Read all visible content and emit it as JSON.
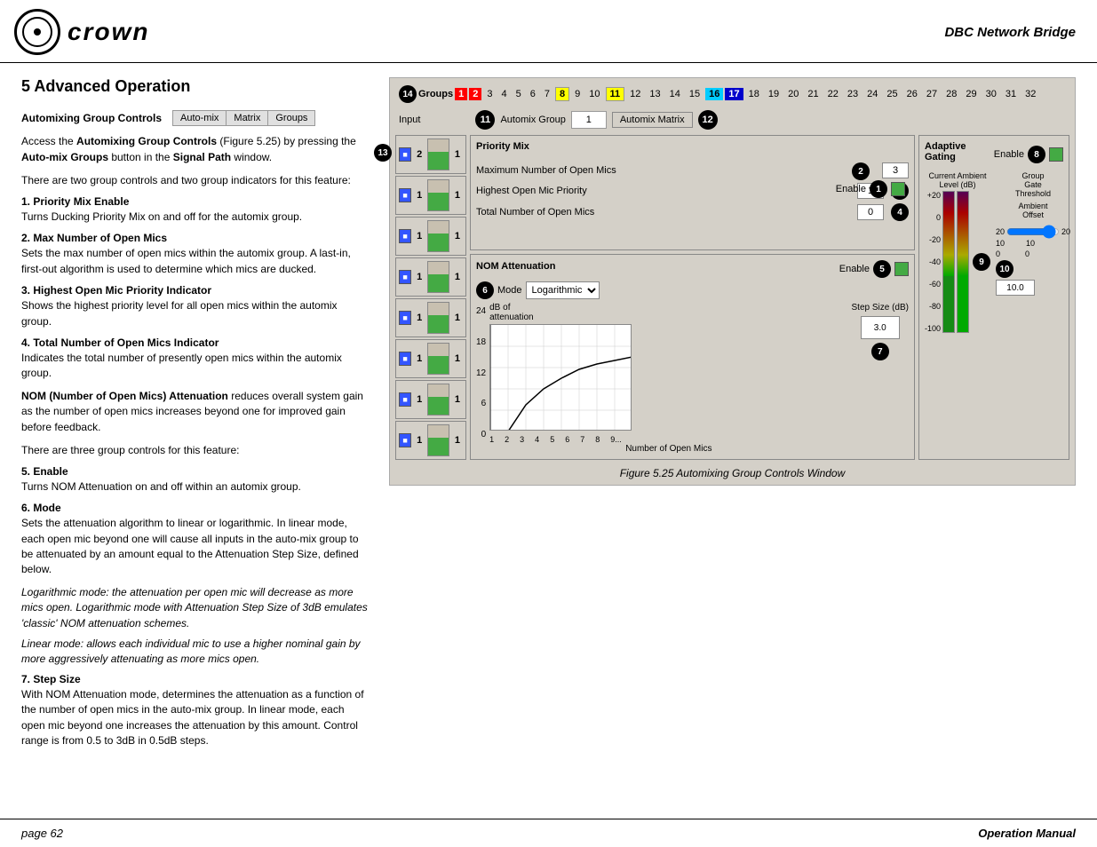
{
  "header": {
    "logo_text": "crown",
    "title": "DBC Network Bridge"
  },
  "page": {
    "section": "5 Advanced Operation",
    "footer_page": "page 62",
    "footer_manual": "Operation Manual"
  },
  "automixing": {
    "group_controls_label": "Automixing Group Controls",
    "tabs": [
      "Auto-mix",
      "Matrix",
      "Groups"
    ],
    "description_1": "Access the ",
    "description_bold": "Automixing Group Controls",
    "description_2": " (Figure 5.25) by pressing the ",
    "description_bold2": "Auto-mix Groups",
    "description_3": " button in the ",
    "description_bold3": "Signal Path",
    "description_4": " window.",
    "description_5": "There are two group controls and two group indicators for this feature:",
    "items": [
      {
        "num": "1.",
        "title": "Priority Mix Enable",
        "body": "Turns Ducking Priority Mix on and off for the automix group."
      },
      {
        "num": "2.",
        "title": "Max Number of Open Mics",
        "body": "Sets the max number of open mics within the automix group. A last-in, first-out algorithm is used to determine which mics are ducked."
      },
      {
        "num": "3.",
        "title": "Highest Open Mic Priority Indicator",
        "body": "Shows the highest priority level for all open mics within the automix group."
      },
      {
        "num": "4.",
        "title": "Total Number of Open Mics Indicator",
        "body": "Indicates the total number of presently open mics within the automix group."
      },
      {
        "num": "NOM",
        "title": "(Number of Open Mics) Attenuation",
        "body_prefix": " reduces overall system gain as the number of open mics increases beyond one for improved gain before feedback."
      },
      {
        "num": "",
        "title": "",
        "body": "There are three group controls for this feature:"
      },
      {
        "num": "5.",
        "title": "Enable",
        "body": "Turns NOM Attenuation on and off within an automix group."
      },
      {
        "num": "6.",
        "title": "Mode",
        "body": "Sets the attenuation algorithm to linear or logarithmic. In linear mode, each open mic beyond one will cause all inputs in the auto-mix group to be attenuated by an amount equal to the Attenuation Step Size, defined below."
      },
      {
        "italic1": "Logarithmic mode:",
        "italic1_body": " the attenuation per open mic will decrease as more mics open. Logarithmic mode with Attenuation Step Size of 3dB emulates 'classic' NOM attenuation schemes."
      },
      {
        "italic2": "Linear mode:",
        "italic2_body": " allows each individual mic to use a higher nominal gain by more aggressively attenuating as more mics open."
      },
      {
        "num": "7.",
        "title": "Step Size",
        "body": "With NOM Attenuation mode, determines the attenuation as a function of the number of open mics in the auto-mix group. In linear mode, each open mic beyond one increases the attenuation by this amount. Control range is from 0.5 to 3dB in 0.5dB steps."
      }
    ]
  },
  "ui": {
    "groups_bar": {
      "badge14": "14",
      "groups_label": "Groups",
      "nums": [
        "1",
        "2",
        "3",
        "4",
        "5",
        "6",
        "7",
        "8",
        "9",
        "10",
        "11",
        "12",
        "13",
        "14",
        "15",
        "16",
        "17",
        "18",
        "19",
        "20",
        "21",
        "22",
        "23",
        "24",
        "25",
        "26",
        "27",
        "28",
        "29",
        "30",
        "31",
        "32"
      ],
      "active_red": "2",
      "active_yellow": "8",
      "active_cyan": "16",
      "active_blue": "17"
    },
    "input_row": {
      "label": "Input",
      "badge11": "11",
      "automix_group_label": "Automix Group",
      "automix_group_value": "1",
      "automix_matrix_label": "Automix Matrix",
      "badge12": "12"
    },
    "priority_mix": {
      "title": "Priority Mix",
      "badge2": "2",
      "max_open_mics_label": "Maximum Number of Open Mics",
      "max_open_mics_value": "3",
      "highest_priority_label": "Highest Open Mic Priority",
      "highest_priority_value": "1",
      "badge3": "3",
      "total_open_mics_label": "Total Number of Open Mics",
      "total_open_mics_value": "0",
      "badge4": "4",
      "enable_label": "Enable",
      "badge1": "1"
    },
    "nom": {
      "title": "NOM Attenuation",
      "enable_label": "Enable",
      "badge5": "5",
      "mode_label": "Mode",
      "badge6": "6",
      "mode_value": "Logarithmic",
      "y_label": "dB of\nattenuation",
      "y_values": [
        "24",
        "18",
        "12",
        "6",
        "0"
      ],
      "x_label": "Number of Open Mics",
      "x_values": [
        "1",
        "2",
        "3",
        "4",
        "5",
        "6",
        "7",
        "8",
        "9..."
      ],
      "step_size_label": "Step Size (dB)",
      "step_size_value": "3.0",
      "badge7": "7"
    },
    "adaptive_gating": {
      "title": "Adaptive Gating",
      "enable_label": "Enable",
      "badge8": "8",
      "current_ambient_label": "Current Ambient\nLevel (dB)",
      "group_gate_label": "Group\nGate\nThreshold",
      "ambient_label": "Ambient\nOffset",
      "meter_labels": [
        "+20",
        "0",
        "-20",
        "-40",
        "-60",
        "-80",
        "-100"
      ],
      "badge9": "9",
      "badge10": "10",
      "ambient_offset_value": "20",
      "threshold_value": "10",
      "bottom_value": "0",
      "spin_value": "10.0"
    }
  },
  "figure_caption": "Figure 5.25  Automixing Group Controls Window"
}
